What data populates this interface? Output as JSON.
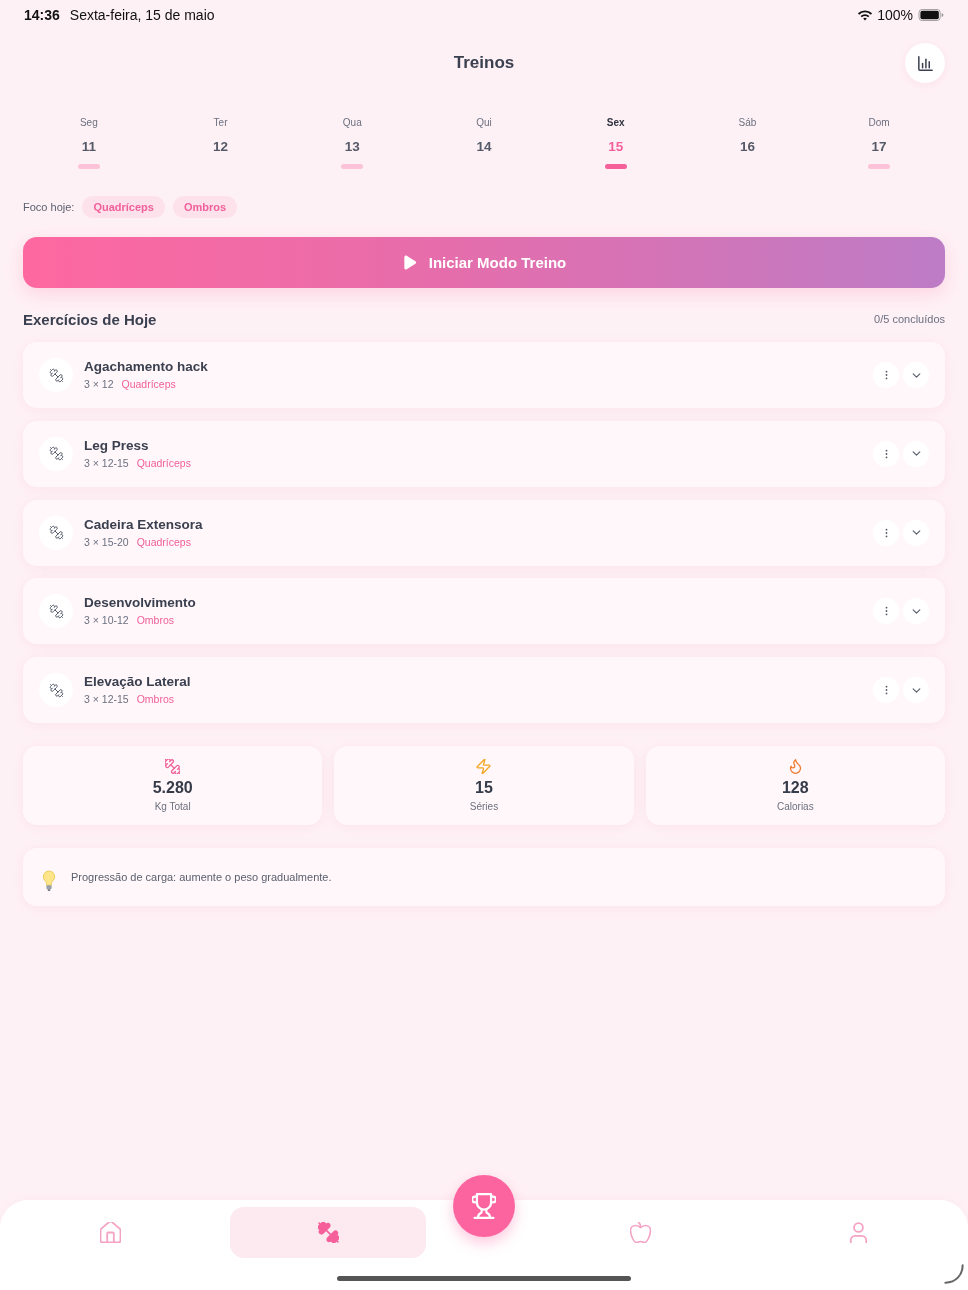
{
  "status_bar": {
    "time": "14:36",
    "date": "Sexta-feira, 15 de maio",
    "battery": "100%"
  },
  "header": {
    "title": "Treinos"
  },
  "week": [
    {
      "day": "Seg",
      "date": "11",
      "selected": false,
      "has_workout": true
    },
    {
      "day": "Ter",
      "date": "12",
      "selected": false,
      "has_workout": false
    },
    {
      "day": "Qua",
      "date": "13",
      "selected": false,
      "has_workout": true
    },
    {
      "day": "Qui",
      "date": "14",
      "selected": false,
      "has_workout": false
    },
    {
      "day": "Sex",
      "date": "15",
      "selected": true,
      "has_workout": true
    },
    {
      "day": "Sáb",
      "date": "16",
      "selected": false,
      "has_workout": false
    },
    {
      "day": "Dom",
      "date": "17",
      "selected": false,
      "has_workout": true
    }
  ],
  "focus": {
    "label": "Foco hoje:",
    "tags": [
      "Quadríceps",
      "Ombros"
    ]
  },
  "start_button": {
    "label": "Iniciar Modo Treino"
  },
  "exercises_header": {
    "title": "Exercícios de Hoje",
    "progress": "0/5 concluídos"
  },
  "exercises": [
    {
      "name": "Agachamento hack",
      "scheme": "3 × 12",
      "muscle": "Quadríceps"
    },
    {
      "name": "Leg Press",
      "scheme": "3 × 12-15",
      "muscle": "Quadríceps"
    },
    {
      "name": "Cadeira Extensora",
      "scheme": "3 × 15-20",
      "muscle": "Quadríceps"
    },
    {
      "name": "Desenvolvimento",
      "scheme": "3 × 10-12",
      "muscle": "Ombros"
    },
    {
      "name": "Elevação Lateral",
      "scheme": "3 × 12-15",
      "muscle": "Ombros"
    }
  ],
  "stats": [
    {
      "kind": "weight",
      "value": "5.280",
      "label": "Kg Total"
    },
    {
      "kind": "sets",
      "value": "15",
      "label": "Séries"
    },
    {
      "kind": "calories",
      "value": "128",
      "label": "Calorias"
    }
  ],
  "tip": {
    "text": "Progressão de carga: aumente o peso gradualmente."
  },
  "nav": [
    {
      "kind": "home",
      "selected": false
    },
    {
      "kind": "workouts",
      "selected": true
    },
    {
      "kind": "trophy",
      "selected": false
    },
    {
      "kind": "nutrition",
      "selected": false
    },
    {
      "kind": "profile",
      "selected": false
    }
  ]
}
